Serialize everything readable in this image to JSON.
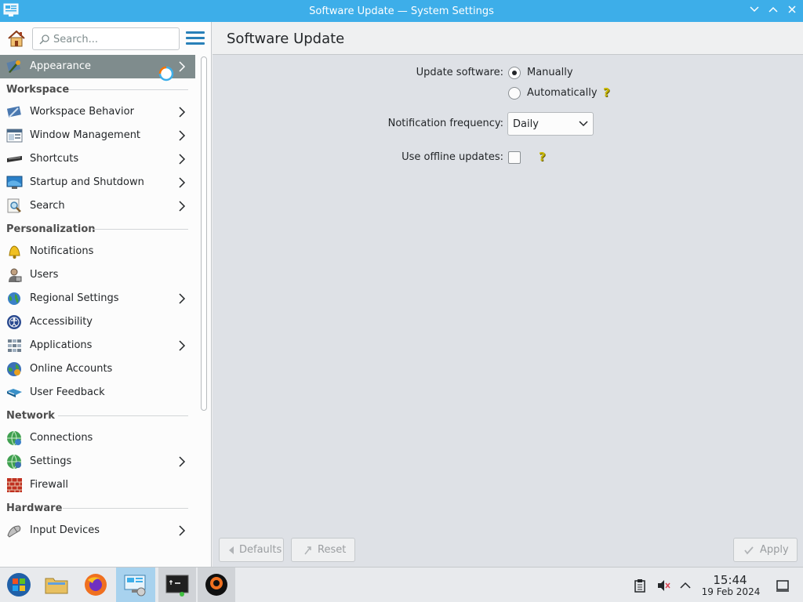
{
  "window": {
    "title": "Software Update — System Settings"
  },
  "sidebar": {
    "search_placeholder": "Search...",
    "appearance": "Appearance",
    "sections": {
      "workspace": "Workspace",
      "personalization": "Personalization",
      "network": "Network",
      "hardware": "Hardware"
    },
    "items": {
      "workspace_behavior": "Workspace Behavior",
      "window_management": "Window Management",
      "shortcuts": "Shortcuts",
      "startup_shutdown": "Startup and Shutdown",
      "search": "Search",
      "notifications": "Notifications",
      "users": "Users",
      "regional_settings": "Regional Settings",
      "accessibility": "Accessibility",
      "applications": "Applications",
      "online_accounts": "Online Accounts",
      "user_feedback": "User Feedback",
      "connections": "Connections",
      "settings": "Settings",
      "firewall": "Firewall",
      "input_devices": "Input Devices"
    }
  },
  "page": {
    "title": "Software Update",
    "update_software_label": "Update software:",
    "option_manually": "Manually",
    "option_automatically": "Automatically",
    "selected_update_mode": "Manually",
    "notification_frequency_label": "Notification frequency:",
    "notification_frequency_value": "Daily",
    "offline_updates_label": "Use offline updates:",
    "offline_updates_checked": false
  },
  "buttons": {
    "defaults": "Defaults",
    "reset": "Reset",
    "apply": "Apply"
  },
  "taskbar": {
    "time": "15:44",
    "date": "19 Feb 2024"
  },
  "colors": {
    "accent": "#3daee9",
    "active_item": "#7f8c8d"
  }
}
